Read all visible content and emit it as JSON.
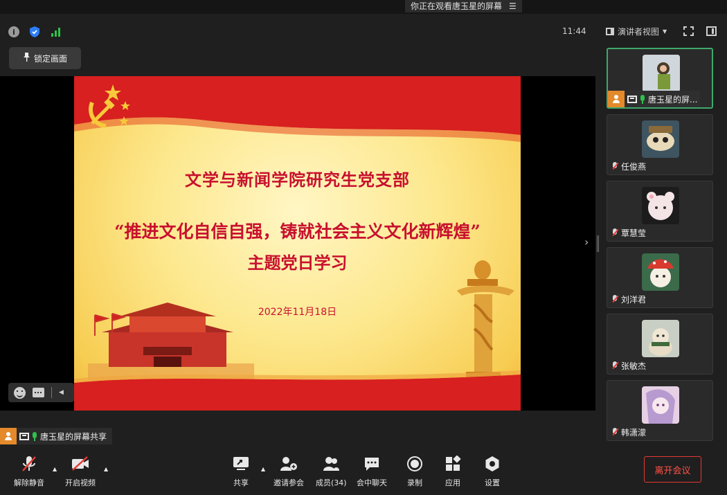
{
  "banner": {
    "viewing_text": "你正在观看唐玉星的屏幕",
    "menu_icon": "list-icon"
  },
  "header": {
    "time": "11:44",
    "view_mode": "演讲者视图"
  },
  "lock_button": {
    "label": "锁定画面",
    "icon": "pin-icon"
  },
  "slide": {
    "title": "文学与新闻学院研究生党支部",
    "theme": "“推进文化自信自强，铸就社会主义文化新辉煌”",
    "subtitle": "主题党日学习",
    "date": "2022年11月18日",
    "colors": {
      "text": "#c8102e",
      "band": "#d7201f",
      "background": "#fde88e"
    }
  },
  "share_label": "唐玉星的屏幕共享",
  "participants": [
    {
      "name": "唐玉星的屏...",
      "active": true,
      "thumb_color": "#bfc6ce"
    },
    {
      "name": "任俊燕",
      "active": false,
      "thumb_color": "#5a6e7a"
    },
    {
      "name": "覃慧莹",
      "active": false,
      "thumb_color": "#d9c7c8"
    },
    {
      "name": "刘洋君",
      "active": false,
      "thumb_color": "#c94a3a"
    },
    {
      "name": "张敏杰",
      "active": false,
      "thumb_color": "#aab3a4"
    },
    {
      "name": "韩潇濛",
      "active": false,
      "thumb_color": "#d7b9d6"
    }
  ],
  "toolbar": {
    "unmute": "解除静音",
    "start_video": "开启视频",
    "share": "共享",
    "invite": "邀请参会",
    "members": "成员(34)",
    "chat": "会中聊天",
    "record": "录制",
    "apps": "应用",
    "settings": "设置",
    "leave": "离开会议"
  }
}
